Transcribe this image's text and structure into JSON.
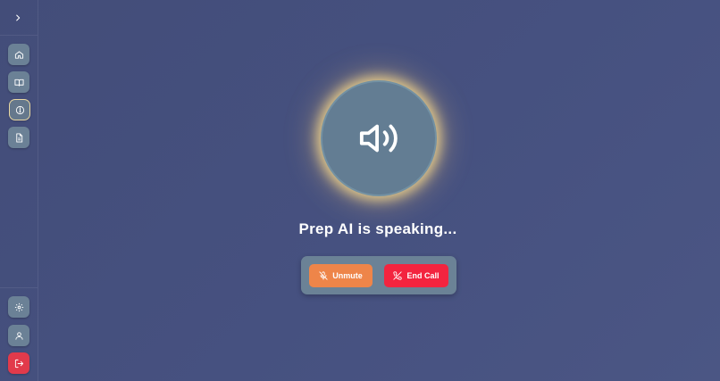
{
  "sidebar": {
    "expand_icon": "chevron-right-icon",
    "nav": [
      {
        "id": "home",
        "icon": "home-icon"
      },
      {
        "id": "library",
        "icon": "book-open-icon"
      },
      {
        "id": "explore",
        "icon": "compass-icon",
        "active": true
      },
      {
        "id": "documents",
        "icon": "file-text-icon"
      }
    ],
    "bottom": [
      {
        "id": "settings",
        "icon": "gear-icon"
      },
      {
        "id": "profile",
        "icon": "user-icon"
      },
      {
        "id": "logout",
        "icon": "logout-icon"
      }
    ]
  },
  "call": {
    "status_text": "Prep AI is speaking...",
    "speaker_icon": "volume-icon",
    "unmute_label": "Unmute",
    "end_call_label": "End Call"
  },
  "colors": {
    "background": "#454f7d",
    "unmute": "#ee8549",
    "end_call": "#f3243f",
    "logout": "#e23a4b",
    "glow": "#ffd98c"
  }
}
